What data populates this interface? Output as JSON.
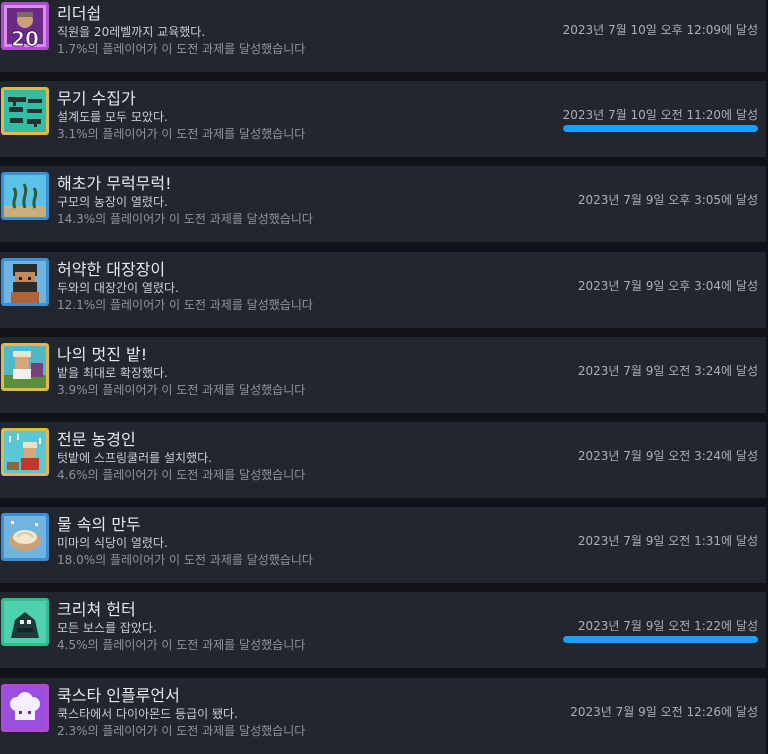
{
  "accent_color": "#1a9fff",
  "achievements": [
    {
      "icon": "leadership-20-icon",
      "title": "리더쉽",
      "description": "직원을 20레벨까지 교육했다.",
      "percent_text": "1.7%의 플레이어가 이 도전 과제를 달성했습니다",
      "unlock_date": "2023년 7월 10일 오후 12:09에 달성",
      "progress": null
    },
    {
      "icon": "weapon-collection-icon",
      "title": "무기 수집가",
      "description": "설계도를 모두 모았다.",
      "percent_text": "3.1%의 플레이어가 이 도전 과제를 달성했습니다",
      "unlock_date": "2023년 7월 10일 오전 11:20에 달성",
      "progress": 1.0
    },
    {
      "icon": "seaweed-icon",
      "title": "해초가 무럭무럭!",
      "description": "구모의 농장이 열렸다.",
      "percent_text": "14.3%의 플레이어가 이 도전 과제를 달성했습니다",
      "unlock_date": "2023년 7월 9일 오후 3:05에 달성",
      "progress": null
    },
    {
      "icon": "blacksmith-portrait-icon",
      "title": "허약한 대장장이",
      "description": "두와의 대장간이 열렸다.",
      "percent_text": "12.1%의 플레이어가 이 도전 과제를 달성했습니다",
      "unlock_date": "2023년 7월 9일 오후 3:04에 달성",
      "progress": null
    },
    {
      "icon": "farmer-field-icon",
      "title": "나의 멋진 밭!",
      "description": "밭을 최대로 확장했다.",
      "percent_text": "3.9%의 플레이어가 이 도전 과제를 달성했습니다",
      "unlock_date": "2023년 7월 9일 오전 3:24에 달성",
      "progress": null
    },
    {
      "icon": "sprinkler-farmer-icon",
      "title": "전문 농경인",
      "description": "텃밭에 스프링쿨러를 설치했다.",
      "percent_text": "4.6%의 플레이어가 이 도전 과제를 달성했습니다",
      "unlock_date": "2023년 7월 9일 오전 3:24에 달성",
      "progress": null
    },
    {
      "icon": "dumpling-bowl-icon",
      "title": "물 속의 만두",
      "description": "미마의 식당이 열렸다.",
      "percent_text": "18.0%의 플레이어가 이 도전 과제를 달성했습니다",
      "unlock_date": "2023년 7월 9일 오전 1:31에 달성",
      "progress": null
    },
    {
      "icon": "creature-hunter-icon",
      "title": "크리쳐 헌터",
      "description": "모든 보스를 잡았다.",
      "percent_text": "4.5%의 플레이어가 이 도전 과제를 달성했습니다",
      "unlock_date": "2023년 7월 9일 오전 1:22에 달성",
      "progress": 1.0
    },
    {
      "icon": "chef-hat-icon",
      "title": "쿡스타 인플루언서",
      "description": "쿡스타에서 다이아몬드 등급이 됐다.",
      "percent_text": "2.3%의 플레이어가 이 도전 과제를 달성했습니다",
      "unlock_date": "2023년 7월 9일 오전 12:26에 달성",
      "progress": null
    }
  ]
}
